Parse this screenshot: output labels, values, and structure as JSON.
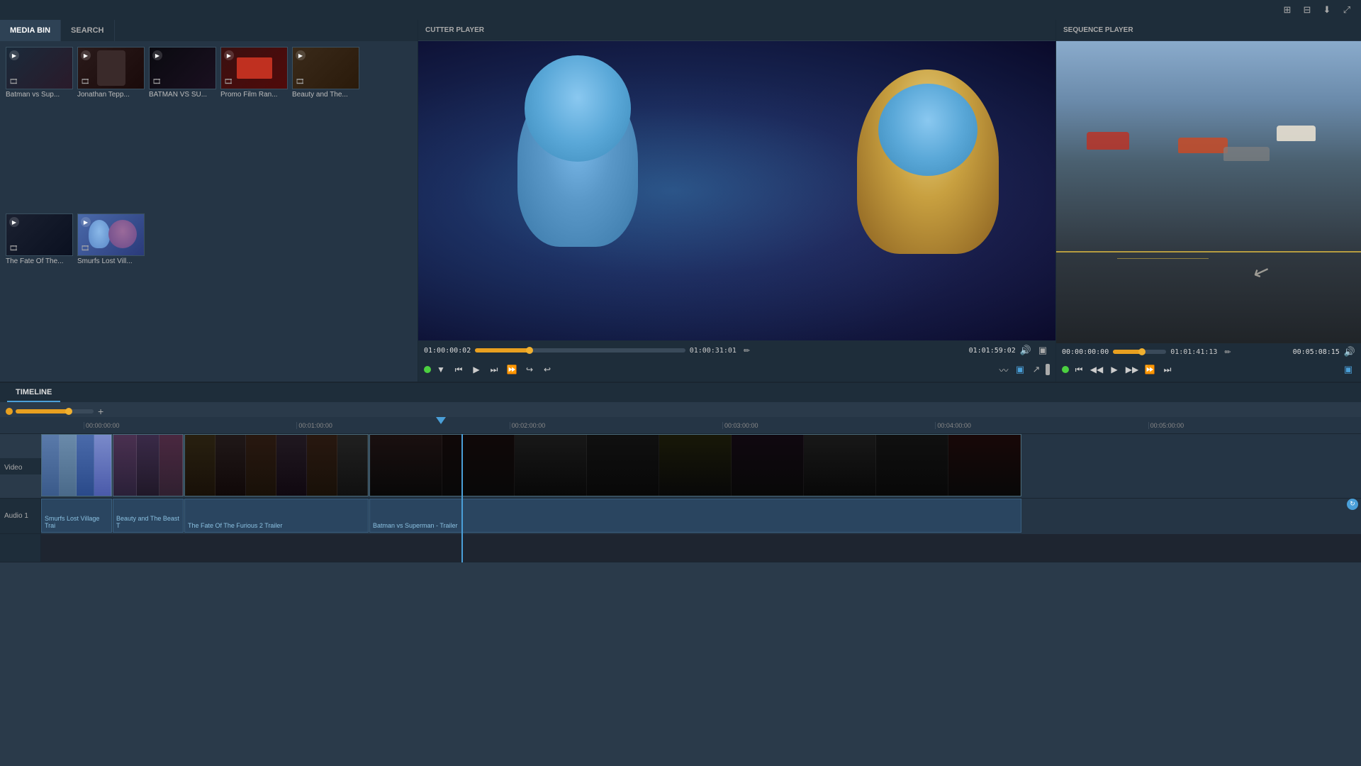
{
  "topbar": {
    "icons": [
      "grid-view",
      "layout-view",
      "download",
      "fullscreen"
    ]
  },
  "mediaBin": {
    "tabs": [
      "MEDIA BIN",
      "SEARCH"
    ],
    "activeTab": "MEDIA BIN",
    "items": [
      {
        "label": "Batman vs Sup...",
        "hasPlay": true,
        "hasMeta": true
      },
      {
        "label": "Jonathan Tepp...",
        "hasPlay": true,
        "hasMeta": true
      },
      {
        "label": "BATMAN VS SU...",
        "hasPlay": true,
        "hasMeta": true
      },
      {
        "label": "Promo Film Ran...",
        "hasPlay": true,
        "hasMeta": true
      },
      {
        "label": "Beauty and The...",
        "hasPlay": true,
        "hasMeta": true
      },
      {
        "label": "The Fate Of The...",
        "hasPlay": true,
        "hasMeta": true
      },
      {
        "label": "Smurfs Lost Vill...",
        "hasPlay": true,
        "hasMeta": true
      }
    ]
  },
  "cutterPlayer": {
    "title": "CUTTER PLAYER",
    "timeIn": "01:00:00:02",
    "timeCurrent": "01:00:31:01",
    "timeOut": "01:01:59:02",
    "progressPercent": 26,
    "controls": {
      "buttons": [
        "to-start",
        "prev-frame",
        "play",
        "next-frame",
        "fast-forward",
        "mark-in",
        "mark-out"
      ],
      "rightButtons": [
        "monitor",
        "forward"
      ]
    }
  },
  "sequencePlayer": {
    "title": "SEQUENCE PLAYER",
    "timeIn": "00:00:00:00",
    "timeCurrent": "01:01:41:13",
    "timeOut": "00:05:08:15",
    "progressPercent": 55,
    "controls": {
      "buttons": [
        "to-start",
        "prev-frame",
        "play",
        "next-frame",
        "fast-forward",
        "end"
      ]
    }
  },
  "timeline": {
    "tabLabel": "TIMELINE",
    "rulerMarks": [
      "00:00:00:00",
      "00:01:00:00",
      "00:02:00:00",
      "00:03:00:00",
      "00:04:00:00",
      "00:05:00:00"
    ],
    "tracks": {
      "video": {
        "label": "Video",
        "clips": [
          {
            "label": "Smurfs Lost Village Trai",
            "color": "#4a6aaa"
          },
          {
            "label": "Beauty and The Beast T",
            "color": "#5a4060"
          },
          {
            "label": "The Fate Of The Furious 2 Trailer",
            "color": "#202020"
          },
          {
            "label": "Batman vs Superman - Trailer",
            "color": "#1a1a18"
          }
        ]
      },
      "audio1": {
        "label": "Audio 1",
        "clips": [
          {
            "label": "Smurfs Lost Village Trai"
          },
          {
            "label": "Beauty and The Beast T"
          },
          {
            "label": "The Fate Of The Furious 2 Trailer"
          },
          {
            "label": "Batman vs Superman - Trailer"
          }
        ]
      }
    }
  }
}
